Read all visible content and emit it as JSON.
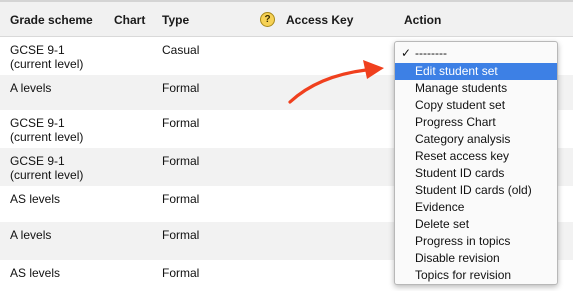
{
  "header": {
    "grade_scheme": "Grade scheme",
    "chart": "Chart",
    "type": "Type",
    "help": "?",
    "access_key": "Access Key",
    "action": "Action"
  },
  "rows": [
    {
      "scheme": "GCSE 9-1\n(current level)",
      "type": "Casual"
    },
    {
      "scheme": "A levels",
      "type": "Formal"
    },
    {
      "scheme": "GCSE 9-1\n(current level)",
      "type": "Formal"
    },
    {
      "scheme": "GCSE 9-1\n(current level)",
      "type": "Formal"
    },
    {
      "scheme": "AS levels",
      "type": "Formal"
    },
    {
      "scheme": "A levels",
      "type": "Formal"
    },
    {
      "scheme": "AS levels",
      "type": "Formal"
    }
  ],
  "action_menu": {
    "checked_mark": "✓",
    "options": [
      "--------",
      "Edit student set",
      "Manage students",
      "Copy student set",
      "Progress Chart",
      "Category analysis",
      "Reset access key",
      "Student ID cards",
      "Student ID cards (old)",
      "Evidence",
      "Delete set",
      "Progress in topics",
      "Disable revision",
      "Topics for revision"
    ],
    "highlighted": "Edit student set"
  },
  "colors": {
    "highlight": "#3d80e5",
    "arrow": "#f0401e",
    "header_bg": "#f1f1f1",
    "stripe": "#f2f2f2"
  }
}
